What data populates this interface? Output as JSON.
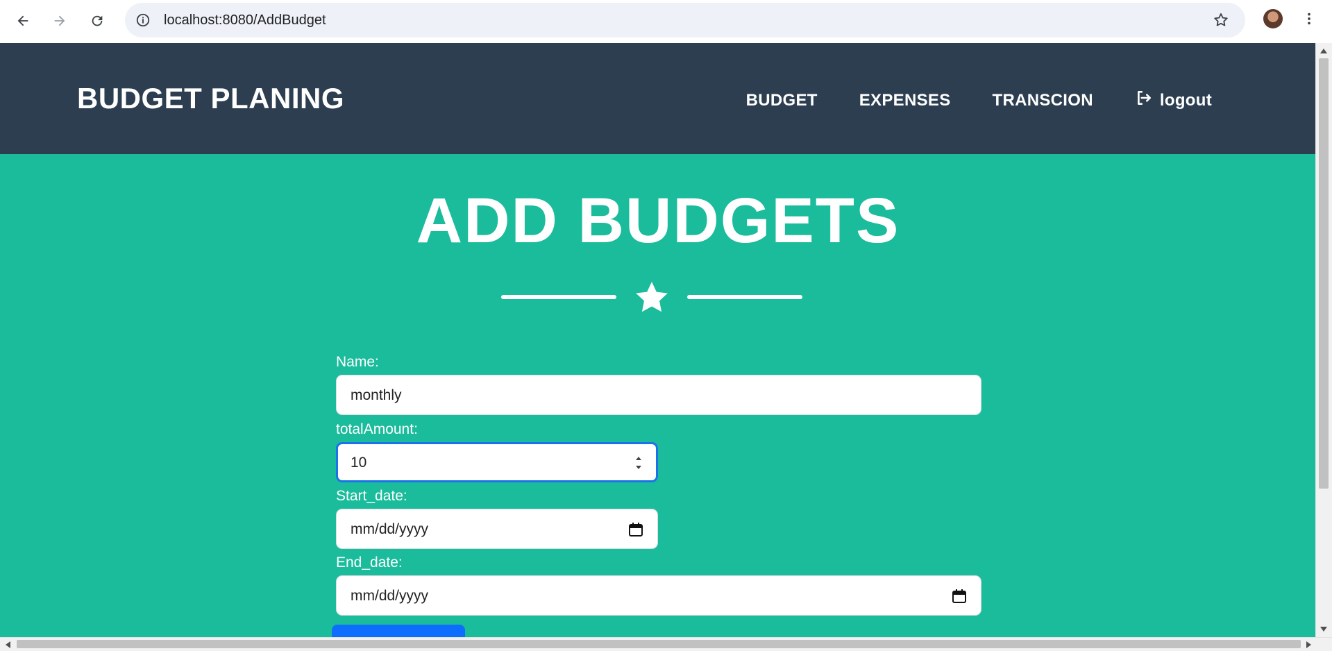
{
  "browser": {
    "url": "localhost:8080/AddBudget",
    "icons": [
      "back-arrow-icon",
      "forward-arrow-icon",
      "reload-icon",
      "info-icon",
      "bookmark-star-icon",
      "profile-avatar",
      "more-vert-icon"
    ]
  },
  "header": {
    "brand": "BUDGET PLANING",
    "nav": [
      {
        "label": "BUDGET"
      },
      {
        "label": "EXPENSES"
      },
      {
        "label": "TRANSCION"
      },
      {
        "label": "logout",
        "icon": "logout-icon"
      }
    ]
  },
  "page": {
    "title": "ADD BUDGETS",
    "divider_icon": "star-icon"
  },
  "form": {
    "name": {
      "label": "Name:",
      "value": "monthly"
    },
    "total_amount": {
      "label": "totalAmount:",
      "value": "10"
    },
    "start_date": {
      "label": "Start_date:",
      "placeholder": "mm/dd/yyyy"
    },
    "end_date": {
      "label": "End_date:",
      "placeholder": "mm/dd/yyyy"
    }
  },
  "colors": {
    "header_bg": "#2c3e50",
    "page_bg": "#1abc9c",
    "focus_ring": "#1a73e8",
    "submit_bg": "#0d6efd"
  }
}
